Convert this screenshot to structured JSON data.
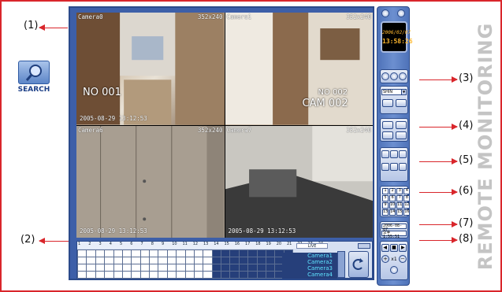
{
  "side_title": "REMOTE MONITORING",
  "search": {
    "label": "SEARCH",
    "icon": "magnifier-icon"
  },
  "callouts": [
    "(1)",
    "(2)",
    "(3)",
    "(4)",
    "(5)",
    "(6)",
    "(7)",
    "(8)"
  ],
  "cameras": [
    {
      "name": "Camera0",
      "resolution": "352x240",
      "timestamp": "2005-08-29 13:12:53",
      "overlay_big": "NO 001",
      "overlay_small": ""
    },
    {
      "name": "Camera1",
      "resolution": "352x240",
      "timestamp": "",
      "overlay_big": "CAM 002",
      "overlay_small": "NO 002"
    },
    {
      "name": "Camera6",
      "resolution": "352x240",
      "timestamp": "2005-08-29 13:12:53",
      "overlay_big": "",
      "overlay_small": ""
    },
    {
      "name": "Camera7",
      "resolution": "352x240",
      "timestamp": "2005-08-29 13:12:53",
      "overlay_big": "",
      "overlay_small": ""
    }
  ],
  "timeline": {
    "hours": [
      "1",
      "2",
      "3",
      "4",
      "5",
      "6",
      "7",
      "8",
      "9",
      "10",
      "11",
      "12",
      "13",
      "14",
      "15",
      "16",
      "17",
      "18",
      "19",
      "20",
      "21",
      "22",
      "23",
      "24"
    ],
    "tag": "LIVE",
    "camera_labels": [
      "Camera1",
      "Camera2",
      "Camera3",
      "Camera4"
    ]
  },
  "clock": {
    "date": "2006/02/07",
    "time": "13:58:26"
  },
  "user_select": "SHIN",
  "numbers": [
    "1",
    "2",
    "3",
    "4",
    "5",
    "6",
    "7",
    "8",
    "9",
    "10",
    "11",
    "12",
    "13",
    "14",
    "15",
    "16"
  ],
  "date_field": "2006-08-07",
  "time_field": "오후 1:55:51",
  "playback": {
    "speed": "x1"
  },
  "colors": {
    "accent_red": "#d9262b",
    "panel_blue": "#3d5fa8",
    "camera_label_cyan": "#5fe4ff",
    "clock_orange": "#ffb82f"
  }
}
